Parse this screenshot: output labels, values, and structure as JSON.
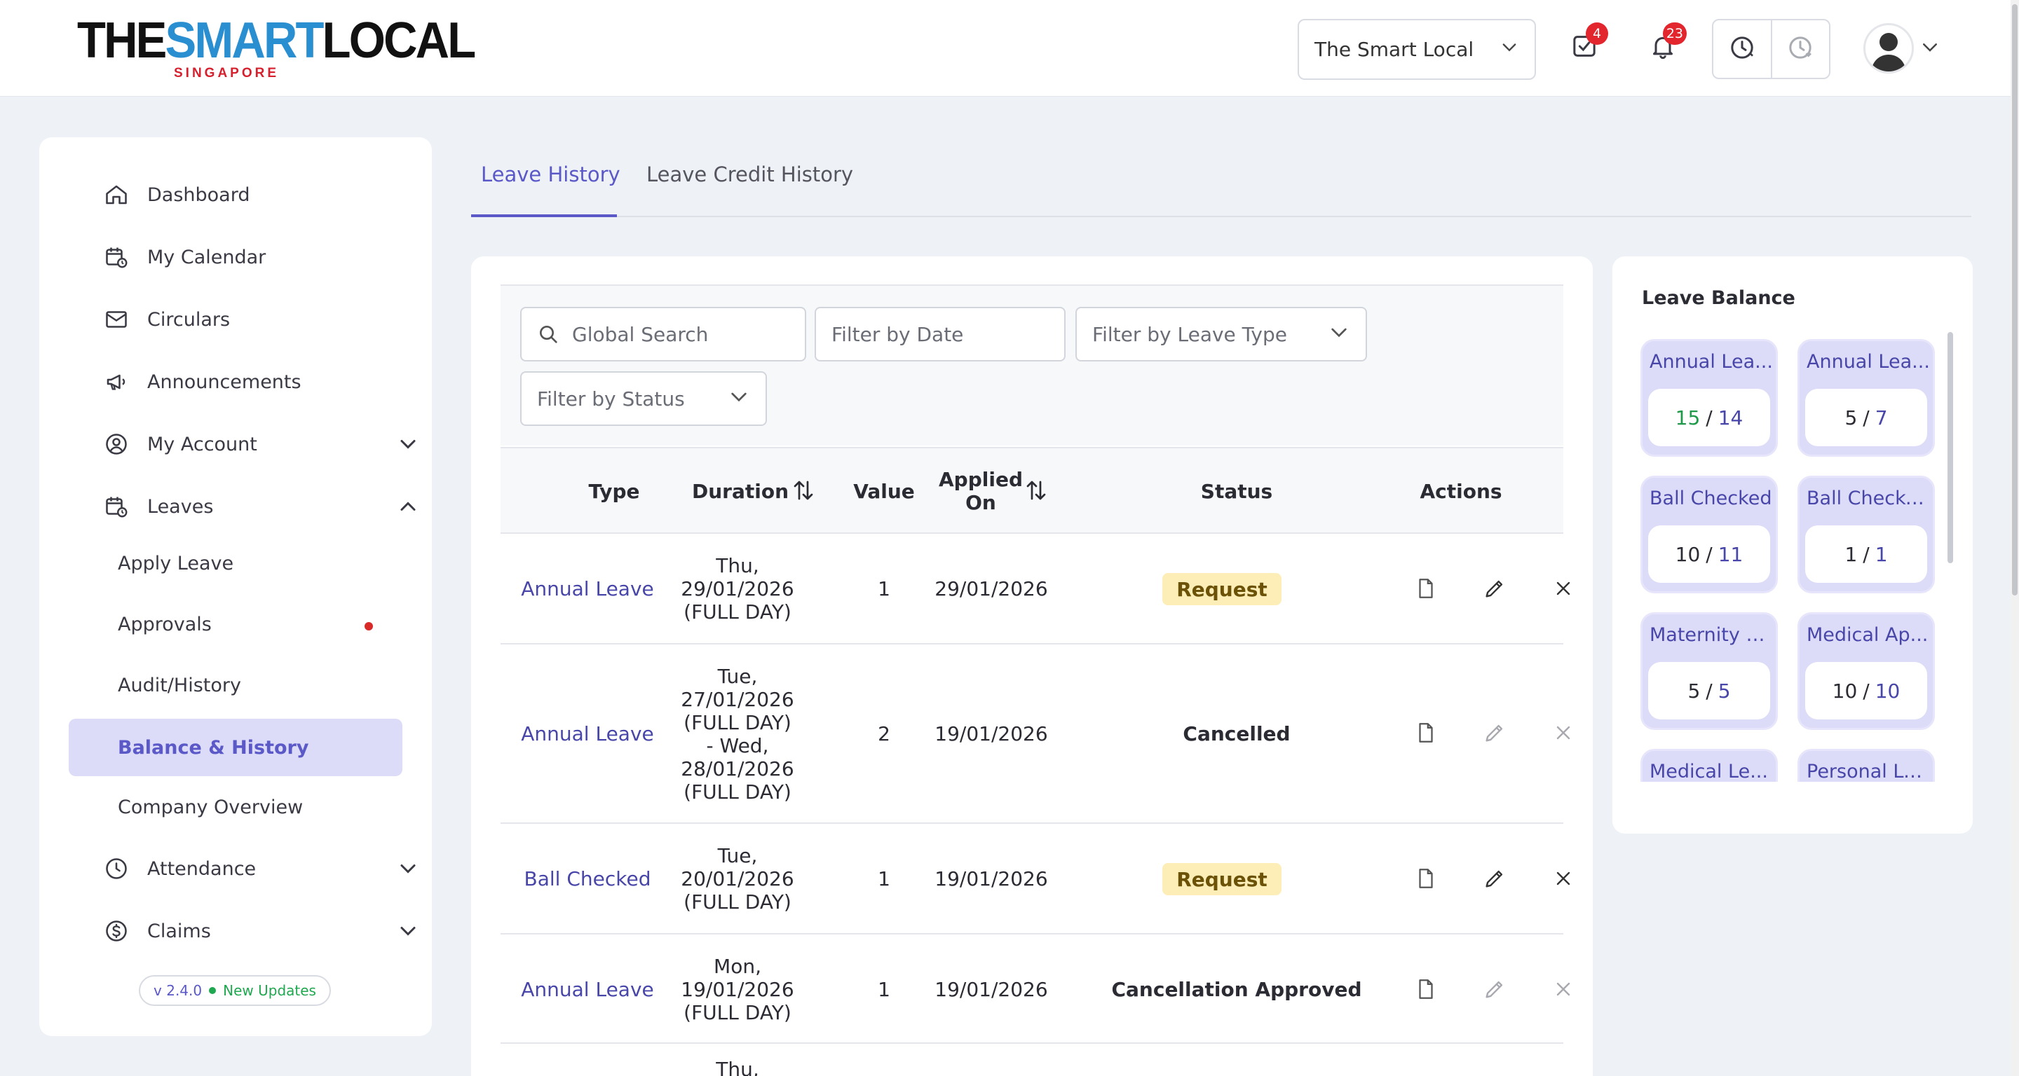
{
  "header": {
    "logo": {
      "the": "THE",
      "smart": "SMART",
      "local": "LOCAL",
      "sub": "SINGAPORE"
    },
    "company": "The Smart Local",
    "tasks_badge": "4",
    "notifications_badge": "23"
  },
  "sidebar": {
    "items": [
      {
        "label": "Dashboard"
      },
      {
        "label": "My Calendar"
      },
      {
        "label": "Circulars"
      },
      {
        "label": "Announcements"
      },
      {
        "label": "My Account"
      },
      {
        "label": "Leaves"
      },
      {
        "label": "Attendance"
      },
      {
        "label": "Claims"
      }
    ],
    "leaves_sub": [
      {
        "label": "Apply Leave"
      },
      {
        "label": "Approvals"
      },
      {
        "label": "Audit/History"
      },
      {
        "label": "Balance & History"
      },
      {
        "label": "Company Overview"
      }
    ],
    "version": "v 2.4.0",
    "updates": "New Updates"
  },
  "tabs": [
    {
      "label": "Leave History"
    },
    {
      "label": "Leave Credit History"
    }
  ],
  "filters": {
    "search_placeholder": "Global Search",
    "date_placeholder": "Filter by Date",
    "leave_type_placeholder": "Filter by Leave Type",
    "status_placeholder": "Filter by Status"
  },
  "table": {
    "headers": {
      "type": "Type",
      "duration": "Duration",
      "value": "Value",
      "applied_line1": "Applied",
      "applied_line2": "On",
      "status": "Status",
      "actions": "Actions"
    },
    "rows": [
      {
        "type": "Annual Leave",
        "duration": [
          "Thu,",
          "29/01/2026",
          "(FULL DAY)"
        ],
        "value": "1",
        "applied": "29/01/2026",
        "status": "Request"
      },
      {
        "type": "Annual Leave",
        "duration": [
          "Tue,",
          "27/01/2026",
          "(FULL DAY)",
          "- Wed,",
          "28/01/2026",
          "(FULL DAY)"
        ],
        "value": "2",
        "applied": "19/01/2026",
        "status": "Cancelled"
      },
      {
        "type": "Ball Checked",
        "duration": [
          "Tue,",
          "20/01/2026",
          "(FULL DAY)"
        ],
        "value": "1",
        "applied": "19/01/2026",
        "status": "Request"
      },
      {
        "type": "Annual Leave",
        "duration": [
          "Mon,",
          "19/01/2026",
          "(FULL DAY)"
        ],
        "value": "1",
        "applied": "19/01/2026",
        "status": "Cancellation Approved"
      },
      {
        "type": "",
        "duration": [
          "Thu,"
        ],
        "value": "",
        "applied": "",
        "status": ""
      }
    ]
  },
  "balance": {
    "title": "Leave Balance",
    "cards": [
      {
        "title": "Annual Lea...",
        "a": "15",
        "b": "14",
        "a_green": true
      },
      {
        "title": "Annual Lea...",
        "a": "5",
        "b": "7",
        "a_green": false
      },
      {
        "title": "Ball Checked",
        "a": "10",
        "b": "11",
        "a_green": false
      },
      {
        "title": "Ball Checke...",
        "a": "1",
        "b": "1",
        "a_green": false
      },
      {
        "title": "Maternity L...",
        "a": "5",
        "b": "5",
        "a_green": false
      },
      {
        "title": "Medical Ap...",
        "a": "10",
        "b": "10",
        "a_green": false
      },
      {
        "title": "Medical Le...",
        "a": "",
        "b": "",
        "a_green": false
      },
      {
        "title": "Personal Le...",
        "a": "",
        "b": "",
        "a_green": false
      }
    ]
  },
  "colors": {
    "accent": "#5a59c7",
    "request_pill": "#fdeeb8",
    "badge": "#e3262e",
    "green": "#1f9a4a"
  }
}
